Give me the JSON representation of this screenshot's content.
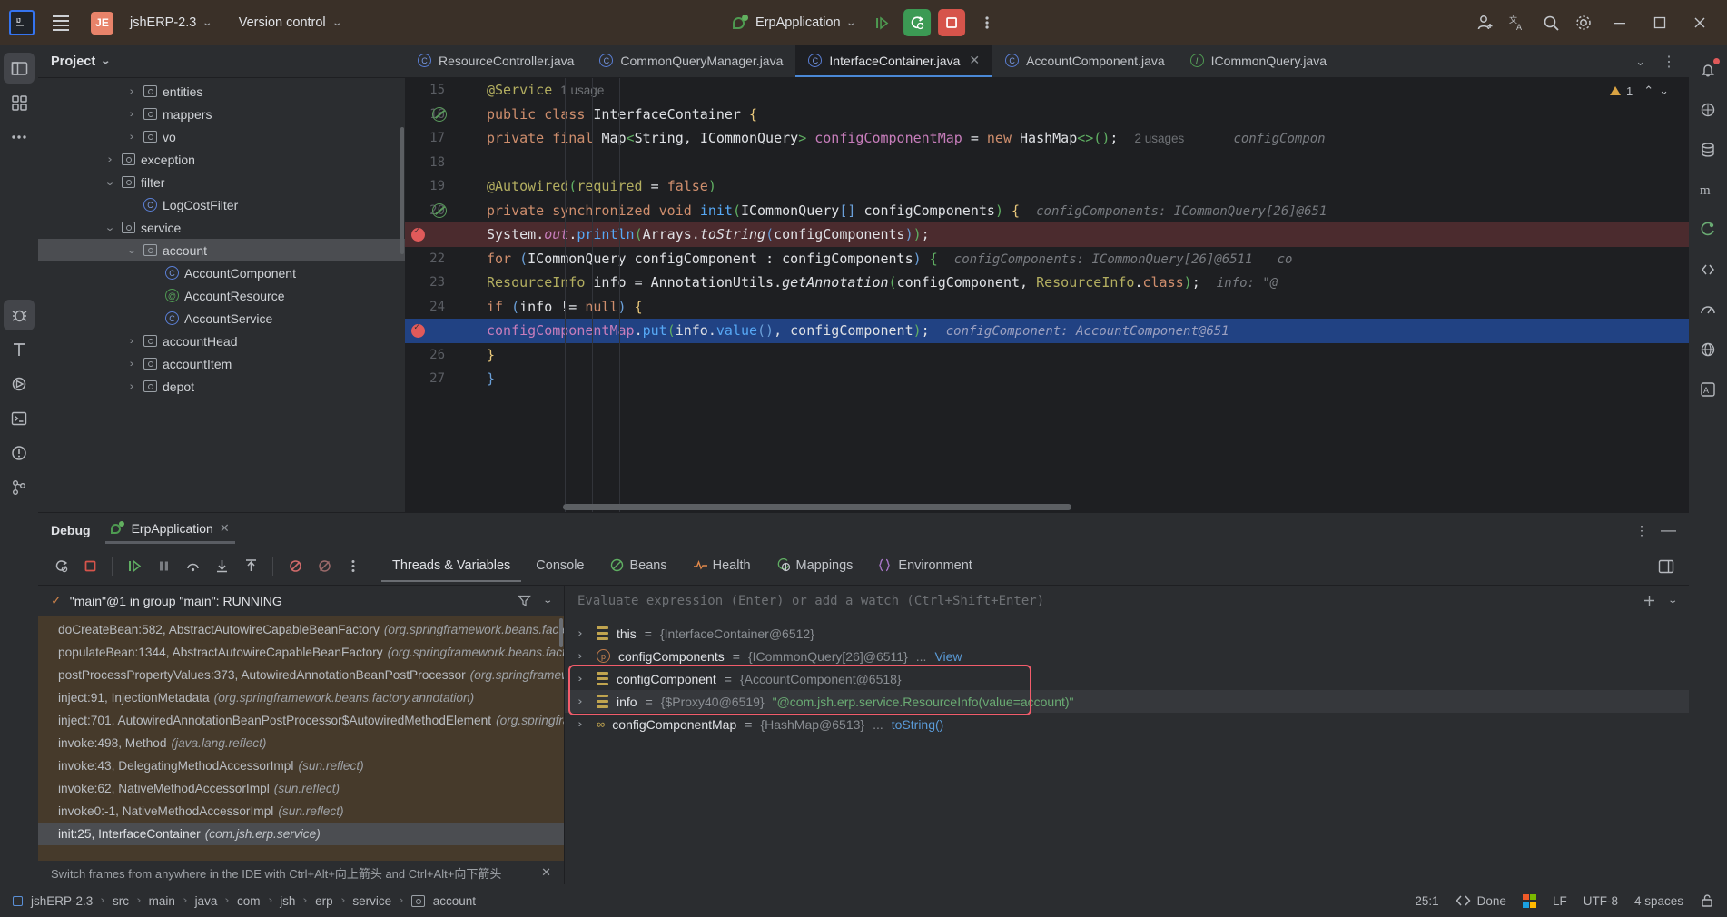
{
  "titlebar": {
    "logo_alt": "IJ",
    "project_badge": "JE",
    "project_name": "jshERP-2.3",
    "vcs_label": "Version control",
    "run_config": "ErpApplication",
    "icons": {
      "menu": "hamburger-icon",
      "run": "run-icon",
      "debug": "debug-icon",
      "stop": "stop-icon",
      "more": "more-vertical-icon",
      "add_user": "add-user-icon",
      "translate": "translate-icon",
      "search": "search-icon",
      "settings": "gear-icon",
      "minimize": "minimize-icon",
      "maximize": "maximize-icon",
      "close": "close-icon"
    }
  },
  "left_strip": [
    "project-icon",
    "structure-icon",
    "more-icon",
    "debug-tool-icon",
    "todo-icon",
    "services-icon",
    "terminal-icon",
    "problems-icon",
    "vcs-icon"
  ],
  "right_strip": [
    "notifications-icon",
    "ai-assistant-icon",
    "database-icon",
    "maven-icon",
    "spring-icon",
    "endpoints-icon",
    "profiler-icon",
    "web-icon",
    "translation-icon"
  ],
  "sidebar": {
    "title": "Project",
    "tree": [
      {
        "label": "entities",
        "type": "folder",
        "arrow": "collapsed",
        "indent": 4,
        "selected": false
      },
      {
        "label": "mappers",
        "type": "folder",
        "arrow": "collapsed",
        "indent": 4,
        "selected": false
      },
      {
        "label": "vo",
        "type": "folder",
        "arrow": "collapsed",
        "indent": 4,
        "selected": false
      },
      {
        "label": "exception",
        "type": "folder",
        "arrow": "collapsed",
        "indent": 3,
        "selected": false
      },
      {
        "label": "filter",
        "type": "folder",
        "arrow": "expanded",
        "indent": 3,
        "selected": false
      },
      {
        "label": "LogCostFilter",
        "type": "class",
        "arrow": "none",
        "indent": 4,
        "selected": false
      },
      {
        "label": "service",
        "type": "folder",
        "arrow": "expanded",
        "indent": 3,
        "selected": false
      },
      {
        "label": "account",
        "type": "folder",
        "arrow": "expanded",
        "indent": 4,
        "selected": true
      },
      {
        "label": "AccountComponent",
        "type": "class",
        "arrow": "none",
        "indent": 5,
        "selected": false
      },
      {
        "label": "AccountResource",
        "type": "annotation",
        "arrow": "none",
        "indent": 5,
        "selected": false
      },
      {
        "label": "AccountService",
        "type": "class",
        "arrow": "none",
        "indent": 5,
        "selected": false
      },
      {
        "label": "accountHead",
        "type": "folder",
        "arrow": "collapsed",
        "indent": 4,
        "selected": false
      },
      {
        "label": "accountItem",
        "type": "folder",
        "arrow": "collapsed",
        "indent": 4,
        "selected": false
      },
      {
        "label": "depot",
        "type": "folder",
        "arrow": "collapsed",
        "indent": 4,
        "selected": false
      }
    ]
  },
  "editor": {
    "tabs": [
      {
        "label": "ResourceController.java",
        "icon": "class-icon",
        "active": false,
        "closable": false
      },
      {
        "label": "CommonQueryManager.java",
        "icon": "class-icon",
        "active": false,
        "closable": false
      },
      {
        "label": "InterfaceContainer.java",
        "icon": "class-icon",
        "active": true,
        "closable": true
      },
      {
        "label": "AccountComponent.java",
        "icon": "class-icon",
        "active": false,
        "closable": false
      },
      {
        "label": "ICommonQuery.java",
        "icon": "interface-icon",
        "active": false,
        "closable": false
      }
    ],
    "warning_count": "1",
    "lines": [
      {
        "num": "15",
        "marker": "none",
        "highlight": "none"
      },
      {
        "num": "16",
        "marker": "run",
        "highlight": "none"
      },
      {
        "num": "17",
        "marker": "none",
        "highlight": "none"
      },
      {
        "num": "18",
        "marker": "none",
        "highlight": "none"
      },
      {
        "num": "19",
        "marker": "none",
        "highlight": "none"
      },
      {
        "num": "20",
        "marker": "run",
        "highlight": "none"
      },
      {
        "num": "21",
        "marker": "breakpoint",
        "highlight": "red"
      },
      {
        "num": "22",
        "marker": "none",
        "highlight": "none"
      },
      {
        "num": "23",
        "marker": "none",
        "highlight": "none"
      },
      {
        "num": "24",
        "marker": "none",
        "highlight": "none"
      },
      {
        "num": "25",
        "marker": "breakpoint",
        "highlight": "blue"
      },
      {
        "num": "26",
        "marker": "none",
        "highlight": "none"
      },
      {
        "num": "27",
        "marker": "none",
        "highlight": "none"
      }
    ],
    "code": {
      "l15_annotation": "@Service",
      "l15_usage": "1 usage",
      "l16": "public class InterfaceContainer {",
      "l17": "private final Map<String, ICommonQuery> configComponentMap = new HashMap<>();",
      "l17_usage": "2 usages",
      "l17_hint": "configCompon",
      "l19": "@Autowired(required = false)",
      "l20": "private synchronized void init(ICommonQuery[] configComponents) {",
      "l20_hint": "configComponents: ICommonQuery[26]@651",
      "l21": "System.out.println(Arrays.toString(configComponents));",
      "l22": "for (ICommonQuery configComponent : configComponents) {",
      "l22_hint": "configComponents: ICommonQuery[26]@6511",
      "l22_hint2": "co",
      "l23": "ResourceInfo info = AnnotationUtils.getAnnotation(configComponent, ResourceInfo.class);",
      "l23_hint": "info: \"@",
      "l24": "if (info != null) {",
      "l25": "configComponentMap.put(info.value(), configComponent);",
      "l25_hint": "configComponent: AccountComponent@651",
      "l26": "}",
      "l27": "}"
    }
  },
  "debug": {
    "title": "Debug",
    "session": "ErpApplication",
    "toolbar_icons": [
      "rerun-icon",
      "stop-icon",
      "resume-icon",
      "pause-icon",
      "step-over-icon",
      "step-into-icon",
      "step-out-icon",
      "mute-breakpoints-icon",
      "view-breakpoints-icon",
      "more-vertical-icon"
    ],
    "tabs": [
      {
        "label": "Threads & Variables",
        "icon": "none",
        "active": true
      },
      {
        "label": "Console",
        "icon": "none",
        "active": false
      },
      {
        "label": "Beans",
        "icon": "beans-icon",
        "active": false
      },
      {
        "label": "Health",
        "icon": "health-icon",
        "active": false
      },
      {
        "label": "Mappings",
        "icon": "mappings-icon",
        "active": false
      },
      {
        "label": "Environment",
        "icon": "environment-icon",
        "active": false
      }
    ],
    "thread_status": "\"main\"@1 in group \"main\": RUNNING",
    "frames": [
      {
        "main": "init:25, InterfaceContainer",
        "pkg": "(com.jsh.erp.service)",
        "selected": true
      },
      {
        "main": "invoke0:-1, NativeMethodAccessorImpl",
        "pkg": "(sun.reflect)",
        "selected": false
      },
      {
        "main": "invoke:62, NativeMethodAccessorImpl",
        "pkg": "(sun.reflect)",
        "selected": false
      },
      {
        "main": "invoke:43, DelegatingMethodAccessorImpl",
        "pkg": "(sun.reflect)",
        "selected": false
      },
      {
        "main": "invoke:498, Method",
        "pkg": "(java.lang.reflect)",
        "selected": false
      },
      {
        "main": "inject:701, AutowiredAnnotationBeanPostProcessor$AutowiredMethodElement",
        "pkg": "(org.springframew",
        "selected": false
      },
      {
        "main": "inject:91, InjectionMetadata",
        "pkg": "(org.springframework.beans.factory.annotation)",
        "selected": false
      },
      {
        "main": "postProcessPropertyValues:373, AutowiredAnnotationBeanPostProcessor",
        "pkg": "(org.springframework.be",
        "selected": false
      },
      {
        "main": "populateBean:1344, AbstractAutowireCapableBeanFactory",
        "pkg": "(org.springframework.beans.factory.sup",
        "selected": false
      },
      {
        "main": "doCreateBean:582, AbstractAutowireCapableBeanFactory",
        "pkg": "(org.springframework.beans.factory.supp",
        "selected": false
      }
    ],
    "hint_bar": "Switch frames from anywhere in the IDE with Ctrl+Alt+向上箭头 and Ctrl+Alt+向下箭头",
    "eval_placeholder": "Evaluate expression (Enter) or add a watch (Ctrl+Shift+Enter)",
    "variables": [
      {
        "icon": "stack-icon",
        "name": "this",
        "value": "{InterfaceContainer@6512}",
        "extra": "",
        "link": "",
        "highlighted": false,
        "boxed": false
      },
      {
        "icon": "param-icon",
        "name": "configComponents",
        "value": "{ICommonQuery[26]@6511}",
        "extra": "...",
        "link": "View",
        "highlighted": false,
        "boxed": false
      },
      {
        "icon": "stack-icon",
        "name": "configComponent",
        "value": "{AccountComponent@6518}",
        "extra": "",
        "link": "",
        "highlighted": false,
        "boxed": true
      },
      {
        "icon": "stack-icon",
        "name": "info",
        "value": "{$Proxy40@6519}",
        "extra": "\"@com.jsh.erp.service.ResourceInfo(value=account)\"",
        "link": "",
        "highlighted": true,
        "boxed": true
      },
      {
        "icon": "map-icon",
        "name": "configComponentMap",
        "value": "{HashMap@6513}",
        "extra": "...",
        "link": "toString()",
        "highlighted": false,
        "boxed": false
      }
    ]
  },
  "status_bar": {
    "breadcrumbs": [
      "jshERP-2.3",
      "src",
      "main",
      "java",
      "com",
      "jsh",
      "erp",
      "service",
      "account"
    ],
    "caret": "25:1",
    "build_status": "Done",
    "line_sep": "LF",
    "encoding": "UTF-8",
    "indent": "4 spaces",
    "lock": "unlocked-icon"
  },
  "colors": {
    "accent_blue": "#3574f0",
    "run_green": "#3c9a54",
    "stop_red": "#d6544b",
    "breakpoint_red": "#e05a5a",
    "highlight_box": "#f25c6b",
    "selection_blue": "#214283",
    "frame_bg": "#463a2b"
  }
}
